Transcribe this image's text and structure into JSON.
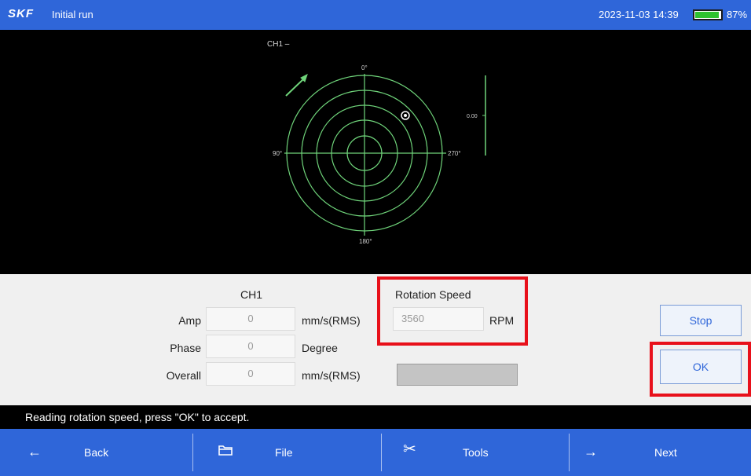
{
  "header": {
    "logo": "SKF",
    "title": "Initial run",
    "datetime": "2023-11-03 14:39",
    "battery_pct": "87%",
    "battery_level": 0.87,
    "color": "#2f66d9"
  },
  "plot": {
    "channel_label": "CH1 –",
    "angle_top": "0°",
    "angle_left": "90°",
    "angle_right": "270°",
    "angle_bottom": "180°",
    "scale_label": "0.00",
    "trace_color": "#6fd47a"
  },
  "measurements": {
    "channel_header": "CH1",
    "amp": {
      "label": "Amp",
      "value": "0",
      "unit": "mm/s(RMS)"
    },
    "phase": {
      "label": "Phase",
      "value": "0",
      "unit": "Degree"
    },
    "overall": {
      "label": "Overall",
      "value": "0",
      "unit": "mm/s(RMS)"
    }
  },
  "rotation": {
    "title": "Rotation Speed",
    "value": "3560",
    "unit": "RPM"
  },
  "buttons": {
    "stop": "Stop",
    "ok": "OK"
  },
  "status_message": "Reading rotation speed, press \"OK\" to accept.",
  "nav": {
    "back": {
      "label": "Back",
      "icon": "arrow-left-icon"
    },
    "file": {
      "label": "File",
      "icon": "folder-icon"
    },
    "tools": {
      "label": "Tools",
      "icon": "tools-icon"
    },
    "next": {
      "label": "Next",
      "icon": "arrow-right-icon"
    }
  },
  "highlight_color": "#e8101a"
}
